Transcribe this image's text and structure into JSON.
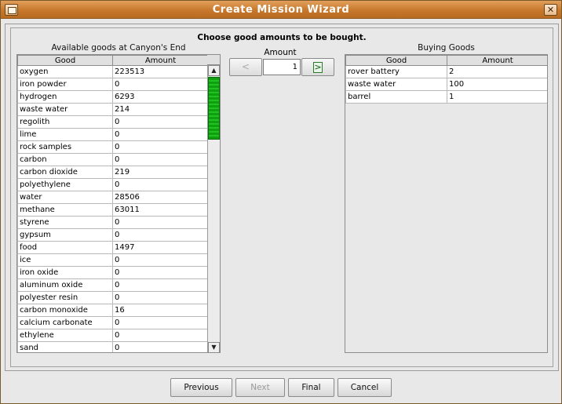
{
  "window": {
    "title": "Create Mission Wizard",
    "close_glyph": "✕"
  },
  "instruction": "Choose good amounts to be bought.",
  "available": {
    "label": "Available goods at Canyon's End",
    "headers": [
      "Good",
      "Amount"
    ],
    "rows": [
      [
        "oxygen",
        "223513"
      ],
      [
        "iron powder",
        "0"
      ],
      [
        "hydrogen",
        "6293"
      ],
      [
        "waste water",
        "214"
      ],
      [
        "regolith",
        "0"
      ],
      [
        "lime",
        "0"
      ],
      [
        "rock samples",
        "0"
      ],
      [
        "carbon",
        "0"
      ],
      [
        "carbon dioxide",
        "219"
      ],
      [
        "polyethylene",
        "0"
      ],
      [
        "water",
        "28506"
      ],
      [
        "methane",
        "63011"
      ],
      [
        "styrene",
        "0"
      ],
      [
        "gypsum",
        "0"
      ],
      [
        "food",
        "1497"
      ],
      [
        "ice",
        "0"
      ],
      [
        "iron oxide",
        "0"
      ],
      [
        "aluminum oxide",
        "0"
      ],
      [
        "polyester resin",
        "0"
      ],
      [
        "carbon monoxide",
        "16"
      ],
      [
        "calcium carbonate",
        "0"
      ],
      [
        "ethylene",
        "0"
      ],
      [
        "sand",
        "0"
      ]
    ],
    "scroll_up_glyph": "▲",
    "scroll_down_glyph": "▼"
  },
  "amount": {
    "label": "Amount",
    "decrease_label": "<",
    "increase_label": ">",
    "value": "1"
  },
  "buying": {
    "label": "Buying Goods",
    "headers": [
      "Good",
      "Amount"
    ],
    "rows": [
      [
        "rover battery",
        "2"
      ],
      [
        "waste water",
        "100"
      ],
      [
        "barrel",
        "1"
      ]
    ]
  },
  "buttons": {
    "previous": "Previous",
    "next": "Next",
    "final": "Final",
    "cancel": "Cancel"
  },
  "colors": {
    "titlebar": "#c7782c",
    "scroll_thumb": "#1fc21f"
  }
}
